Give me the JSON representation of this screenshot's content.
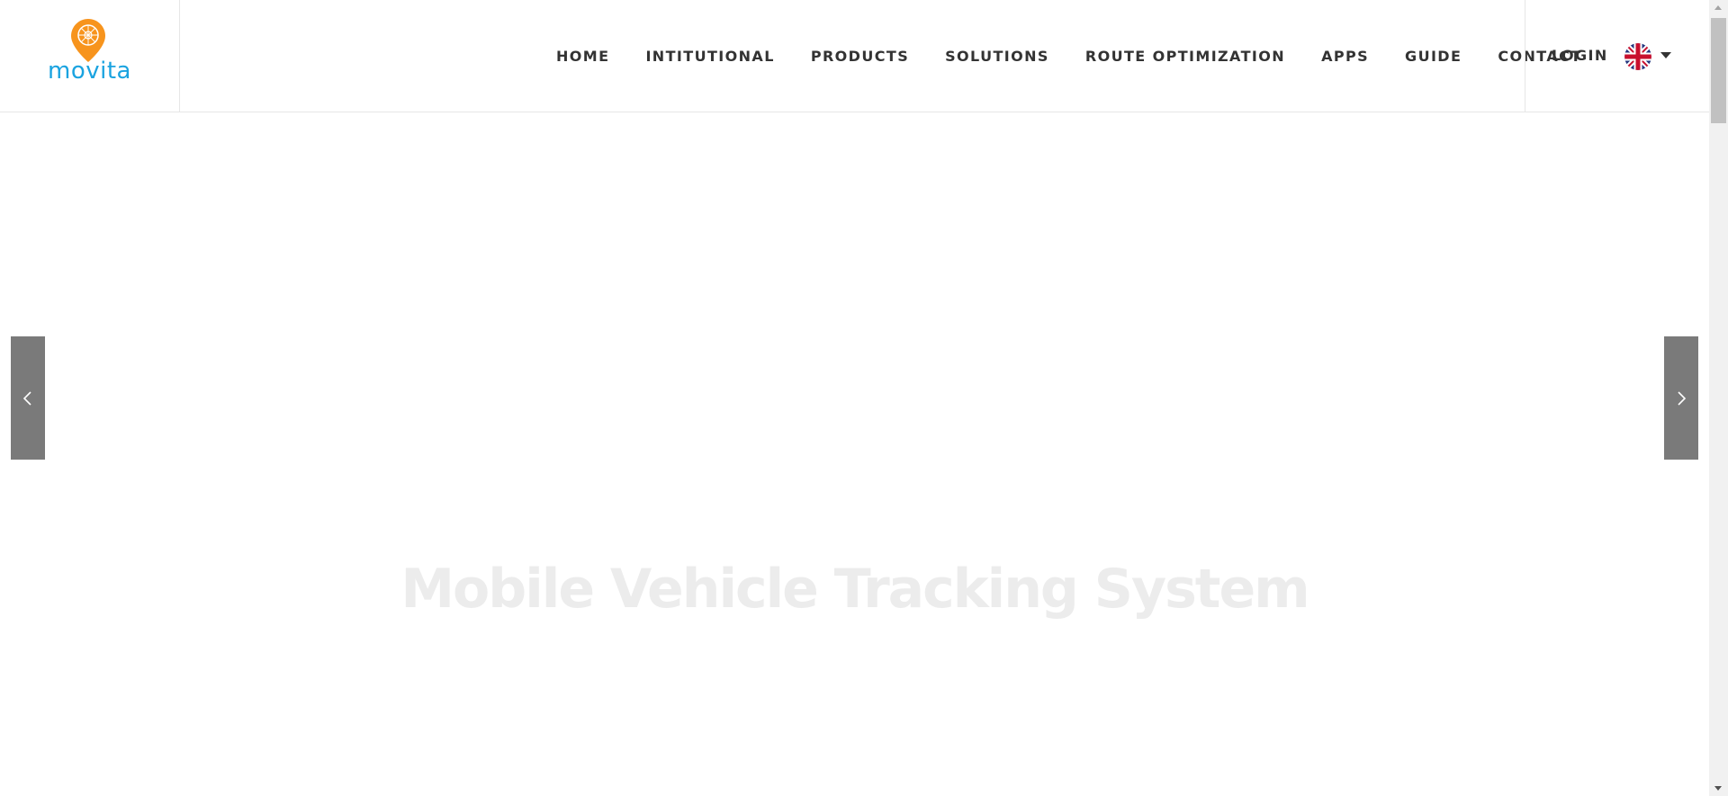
{
  "brand": {
    "name": "movita",
    "pin_color": "#f7941d",
    "text_color": "#1aa3e0"
  },
  "nav": {
    "items": [
      {
        "label": "HOME"
      },
      {
        "label": "INTITUTIONAL"
      },
      {
        "label": "PRODUCTS"
      },
      {
        "label": "SOLUTIONS"
      },
      {
        "label": "ROUTE OPTIMIZATION"
      },
      {
        "label": "APPS"
      },
      {
        "label": "GUIDE"
      },
      {
        "label": "CONTACT"
      }
    ],
    "login_label": "LOGIN",
    "language_icon": "uk-flag-icon"
  },
  "slider": {
    "headline": "Mobile Vehicle Tracking System",
    "prev_icon": "chevron-left-icon",
    "next_icon": "chevron-right-icon",
    "arrow_color": "#7a7a7a"
  }
}
